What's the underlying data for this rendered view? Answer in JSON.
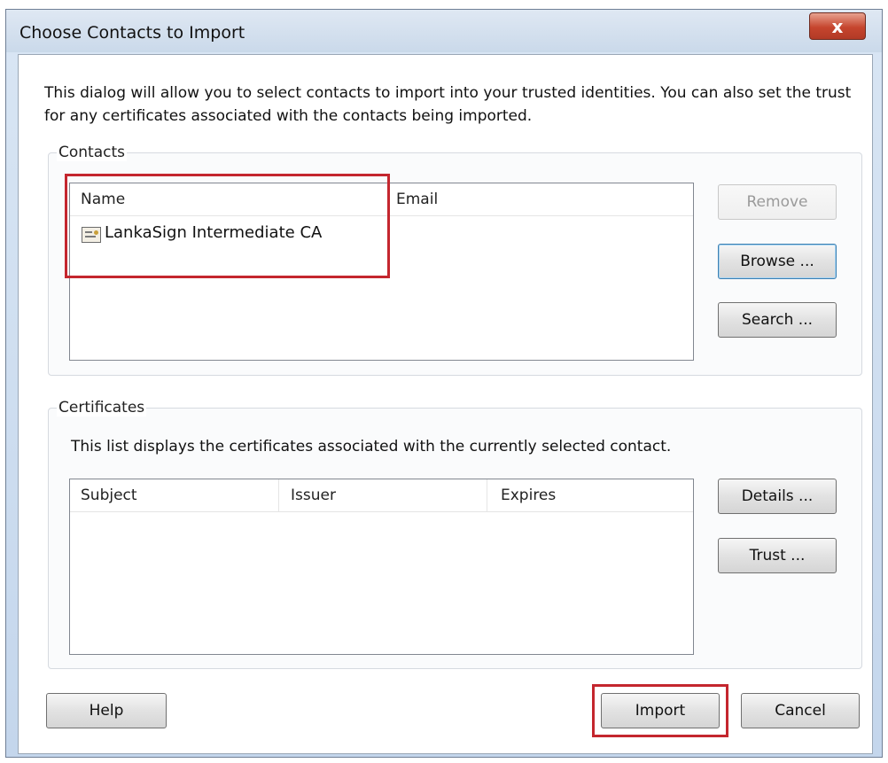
{
  "window": {
    "title": "Choose Contacts to Import",
    "close_glyph": "x"
  },
  "intro_text": "This dialog will allow you to select contacts to import into your trusted identities. You can also set the trust for any certificates associated with the contacts being imported.",
  "contacts": {
    "group_label": "Contacts",
    "columns": [
      "Name",
      "Email"
    ],
    "rows": [
      {
        "icon": "certificate-icon",
        "name": "LankaSign Intermediate CA",
        "email": ""
      }
    ],
    "buttons": {
      "remove": "Remove",
      "browse": "Browse ...",
      "search": "Search ..."
    }
  },
  "certificates": {
    "group_label": "Certificates",
    "description": "This list displays the certificates associated with the currently selected contact.",
    "columns": [
      "Subject",
      "Issuer",
      "Expires"
    ],
    "buttons": {
      "details": "Details ...",
      "trust": "Trust ..."
    }
  },
  "footer": {
    "help": "Help",
    "import": "Import",
    "cancel": "Cancel"
  },
  "colors": {
    "highlight_box": "#c4262e",
    "close_button": "#c6452e"
  }
}
